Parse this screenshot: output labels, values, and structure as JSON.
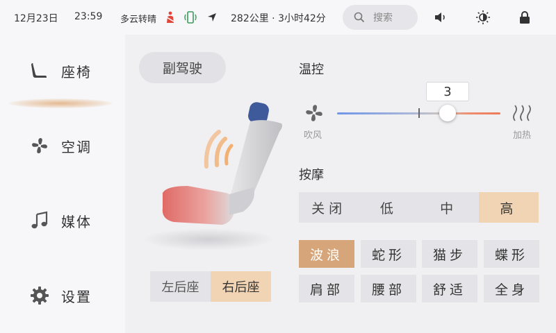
{
  "status": {
    "date": "12月23日",
    "time": "23:59",
    "weather": "多云转晴",
    "range": "282公里 · 3小时42分",
    "search_placeholder": "搜索"
  },
  "sidebar": {
    "items": [
      {
        "label": "座椅",
        "icon": "seat-icon",
        "active": true
      },
      {
        "label": "空调",
        "icon": "fan-icon",
        "active": false
      },
      {
        "label": "媒体",
        "icon": "music-note-icon",
        "active": false
      },
      {
        "label": "设置",
        "icon": "gear-icon",
        "active": false
      }
    ]
  },
  "seat": {
    "passenger_label": "副驾驶",
    "rear_options": [
      "左后座",
      "右后座"
    ],
    "rear_selected": "右后座"
  },
  "climate": {
    "title": "温控",
    "value": "3",
    "left_label": "吹风",
    "right_label": "加热",
    "slider_fraction": 0.67
  },
  "massage": {
    "title": "按摩",
    "levels": [
      "关闭",
      "低",
      "中",
      "高"
    ],
    "level_selected": "高",
    "modes": [
      "波浪",
      "蛇形",
      "猫步",
      "蝶形",
      "肩部",
      "腰部",
      "舒适",
      "全身"
    ],
    "mode_selected": "波浪"
  },
  "colors": {
    "accent": "#d6a67a",
    "accent_light": "#f1d4b3",
    "cool": "#6f96e8",
    "warm": "#ec7a5a"
  }
}
